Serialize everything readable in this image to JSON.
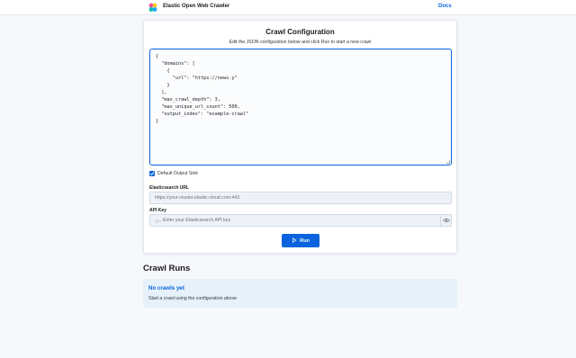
{
  "header": {
    "app_title": "Elastic Open Web Crawler",
    "docs_label": "Docs"
  },
  "config": {
    "title": "Crawl Configuration",
    "subtitle": "Edit the JSON configuration below and click Run to start a new crawl",
    "json_lines": [
      "{",
      "  \"domains\": [",
      "    {",
      "      \"url\": \"https://news.y\"",
      "    }",
      "  ],",
      "  \"max_crawl_depth\": 3,",
      "  \"max_unique_url_count\": 500,",
      "  \"output_index\": \"example-crawl\"",
      "}"
    ],
    "default_output_sink": {
      "label": "Default Output Sink",
      "checked": true
    },
    "elasticsearch_url": {
      "label": "Elasticsearch URL",
      "placeholder": "https://your-cluster.elastic-cloud.com:443",
      "value": ""
    },
    "api_key": {
      "label": "API Key",
      "placeholder": "Enter your Elasticsearch API key",
      "value": ""
    },
    "run_label": "Run"
  },
  "crawl_runs": {
    "title": "Crawl Runs",
    "empty_title": "No crawls yet",
    "empty_text": "Start a crawl using the configuration above"
  },
  "colors": {
    "primary": "#0b64dd",
    "background": "#f7f8fc",
    "empty_bg": "#e6f1fa"
  },
  "icons": {
    "logo": "elastic-logo-icon",
    "key": "key-icon",
    "eye": "eye-icon",
    "play": "play-icon",
    "check": "check-icon"
  }
}
